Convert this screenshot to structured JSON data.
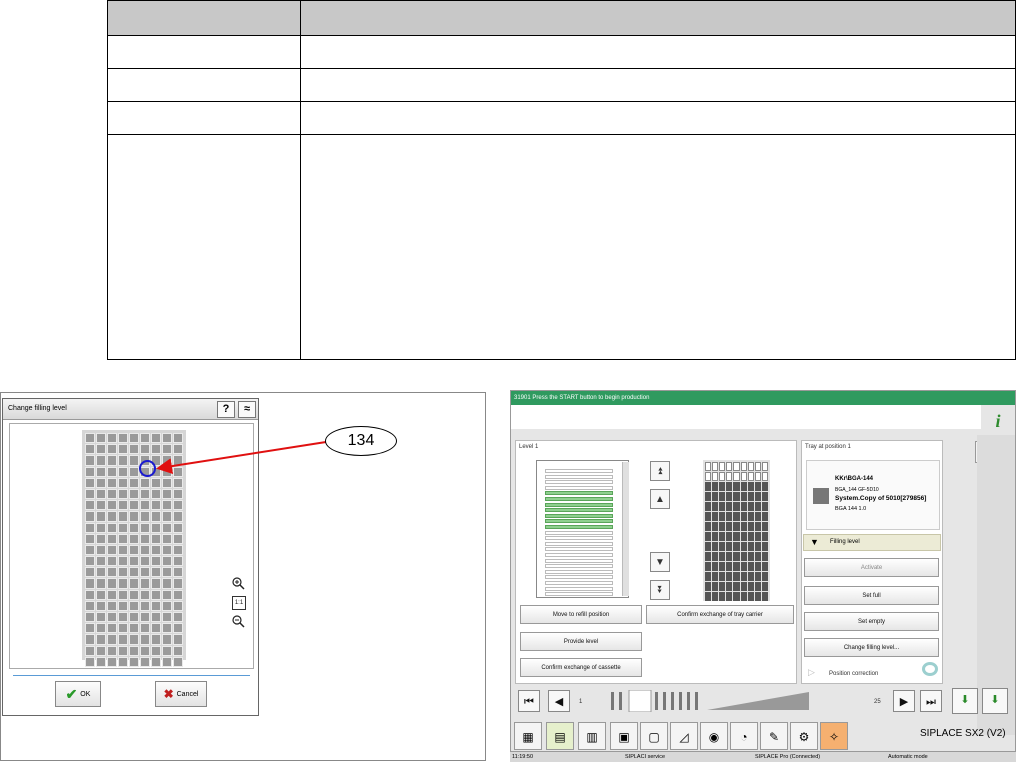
{
  "doc_table": {
    "rows": [
      {
        "c1": "",
        "c2": ""
      },
      {
        "c1": "",
        "c2": ""
      },
      {
        "c1": "",
        "c2": ""
      },
      {
        "c1": "",
        "c2": ""
      },
      {
        "c1": "",
        "c2": ""
      }
    ]
  },
  "dialog": {
    "title": "Change filling level",
    "help_label": "?",
    "collapse_label": "≈",
    "zoom_in_icon": "zoom-in-icon",
    "zoom_fit_label": "1:1",
    "zoom_out_icon": "zoom-out-icon",
    "ok_label": "OK",
    "cancel_label": "Cancel"
  },
  "callout": {
    "number": "134"
  },
  "siplace": {
    "status_message": "31901 Press the START button to begin production",
    "level_label": "Level 1",
    "tray_position_label": "Tray at position 1",
    "component": {
      "name": "KKr\\BGA-144",
      "line2": "BGA_144 GF-5D10",
      "setup": "System.Copy of 5010[279856]",
      "line4": "BGA 144 1.0"
    },
    "filling_level_label": "Filling level",
    "buttons": {
      "activate": "Activate",
      "set_full": "Set full",
      "set_empty": "Set empty",
      "change_filling": "Change filling level...",
      "move_refill": "Move to refill position",
      "confirm_tray": "Confirm exchange of tray carrier",
      "provide_level": "Provide level",
      "confirm_cassette": "Confirm exchange of cassette"
    },
    "position_correction": "Position correction",
    "scrub_start": "1",
    "scrub_end": "25",
    "machine_name": "SIPLACE SX2 (V2)",
    "bottom": {
      "time": "11:19:50",
      "service": "SIPLACI service",
      "pro": "SIPLACE Pro (Connected)",
      "mode": "Automatic mode"
    }
  },
  "colors": {
    "status_green": "#2f9a5f",
    "marker_blue": "#1a1ad0",
    "arrow_red": "#e01010"
  }
}
